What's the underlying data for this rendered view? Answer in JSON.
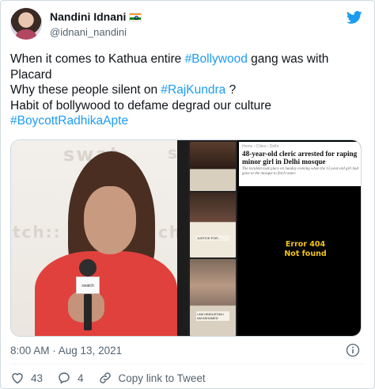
{
  "tweet": {
    "author_name": "Nandini Idnani",
    "handle": "@idnani_nandini",
    "lines": [
      [
        {
          "t": "When it comes to Kathua entire ",
          "tag": false
        },
        {
          "t": "#Bollywood",
          "tag": true
        },
        {
          "t": " gang was with",
          "tag": false
        }
      ],
      [
        {
          "t": "Placard",
          "tag": false
        }
      ],
      [
        {
          "t": "Why these people silent on ",
          "tag": false
        },
        {
          "t": "#RajKundra",
          "tag": true
        },
        {
          "t": " ?",
          "tag": false
        }
      ],
      [
        {
          "t": "Habit of bollywood to defame degrad our culture",
          "tag": false
        }
      ],
      [
        {
          "t": "#BoycottRadhikaApte",
          "tag": true
        }
      ]
    ],
    "timestamp": "8:00 AM · Aug 13, 2021",
    "like_count": "43",
    "reply_count": "4",
    "copy_link_label": "Copy link to Tweet"
  },
  "media": {
    "left_photo_text_top": "swat",
    "left_photo_text_mid": "tch::",
    "left_photo_text_right": "s",
    "left_photo_text_right2": "ch",
    "mic_flag_text": "swatch",
    "news_breadcrumb": "Home › Cities › Delhi",
    "news_headline": "48-year-old cleric arrested for raping minor girl in Delhi mosque",
    "news_sub": "The incident took place on Sunday evening when the 12-year-old girl had gone to the mosque to fetch water.",
    "error_line1": "Error 404",
    "error_line2": "Not found",
    "thumb_label_1": "I'M HINDUSTAN...",
    "thumb_label_2": "JUSTICE FOR...",
    "thumb_label_3": "I AM HINDUSTAN I AM ASHAMED"
  },
  "colors": {
    "link": "#1d9bf0",
    "twitter_blue": "#1d9bf0",
    "muted_text": "#536471",
    "error_text": "#f3c318"
  },
  "icons": [
    "twitter-bird-icon",
    "india-flag-icon",
    "info-icon",
    "heart-icon",
    "reply-icon",
    "link-icon"
  ]
}
